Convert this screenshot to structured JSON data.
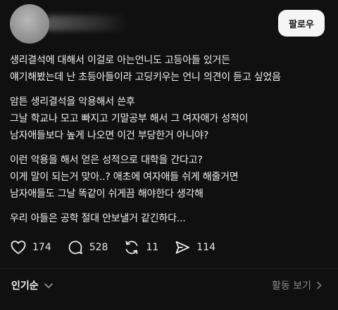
{
  "header": {
    "follow_label": "팔로우"
  },
  "post": {
    "paragraphs": [
      [
        "생리결석에 대해서 이걸로 아는언니도 고등아들 있거든",
        "얘기해봤는데 난 초등아들이라 고딩키우는 언니 의견이 듣고 싶었음"
      ],
      [
        "암튼 생리결석을 악용해서 쓴후",
        "그날 학교나 모고 빠지고 기말공부 해서 그 여자애가 성적이",
        "남자애들보다 높게 나오면 이건 부당한거 아니야?"
      ],
      [
        "이런 악용을 해서 얻은 성적으로 대학을 간다고?",
        "이게 말이 되는거 맞아..? 애초에 여자애들 쉬게 해줄거면",
        "남자애들도 그날 똑같이 쉬게끔 해야한다 생각해"
      ],
      [
        "우리 아들은 공학 절대 안보낼거 같긴하다..."
      ]
    ]
  },
  "actions": {
    "like_count": "174",
    "comment_count": "528",
    "repost_count": "11",
    "share_count": "114"
  },
  "footer": {
    "sort_label": "인기순",
    "activity_label": "활동 보기"
  },
  "icons": {
    "like": "heart-icon",
    "comment": "speech-bubble-icon",
    "repost": "repost-arrows-icon",
    "share": "paper-plane-icon",
    "sort": "chevron-down-icon",
    "activity": "chevron-right-icon"
  },
  "colors": {
    "background": "#101010",
    "text": "#f3f3f3",
    "muted": "#8a8a8a",
    "button_bg": "#f5f5f5"
  }
}
